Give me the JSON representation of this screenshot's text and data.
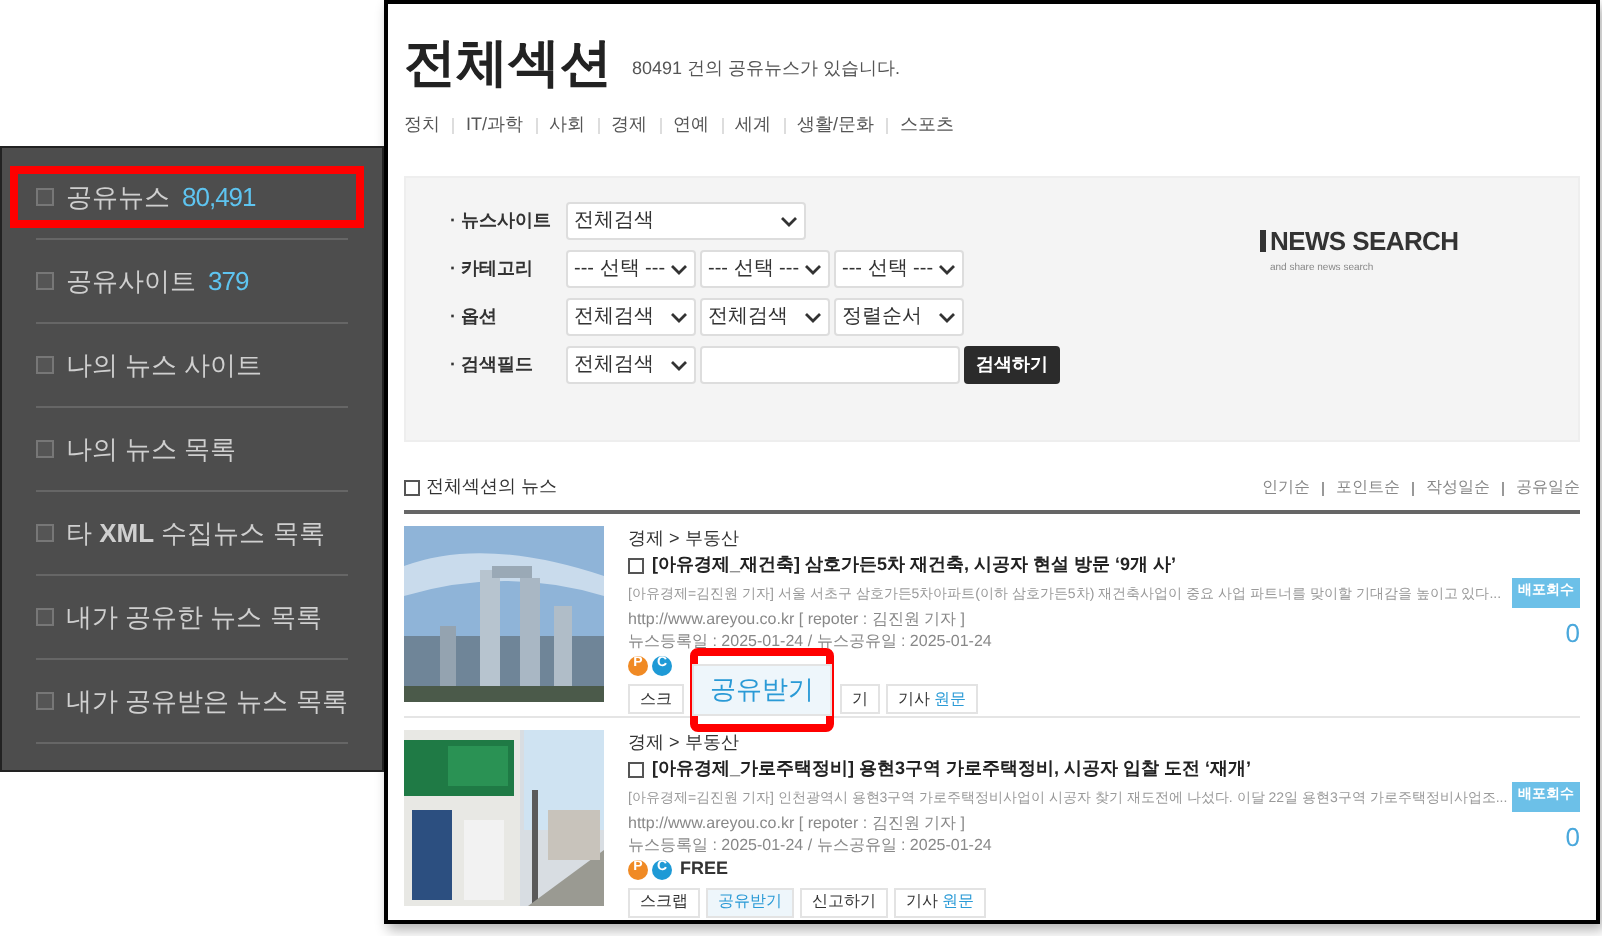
{
  "sidebar": {
    "items": [
      {
        "label": "공유뉴스",
        "count": "80,491",
        "highlighted": true
      },
      {
        "label": "공유사이트",
        "count": "379",
        "highlighted": false
      },
      {
        "label": "나의 뉴스 사이트",
        "highlighted": false
      },
      {
        "label": "나의 뉴스 목록",
        "highlighted": false
      },
      {
        "label": "타 **XML** 수집뉴스 목록",
        "highlighted": false
      },
      {
        "label": "내가 공유한 뉴스 목록",
        "highlighted": false
      },
      {
        "label": "내가 공유받은 뉴스 목록",
        "highlighted": false
      }
    ]
  },
  "page": {
    "title": "전체섹션",
    "subtitle": "80491 건의 공유뉴스가 있습니다.",
    "categories": [
      "정치",
      "IT/과학",
      "사회",
      "경제",
      "연예",
      "세계",
      "생활/문화",
      "스포츠"
    ]
  },
  "search": {
    "rows": [
      {
        "label": "· 뉴스사이트",
        "fields": [
          {
            "kind": "select",
            "value": "전체검색",
            "wide": true
          }
        ]
      },
      {
        "label": "· 카테고리",
        "fields": [
          {
            "kind": "select",
            "value": "--- 선택 ---"
          },
          {
            "kind": "select",
            "value": "--- 선택 ---"
          },
          {
            "kind": "select",
            "value": "--- 선택 ---"
          }
        ]
      },
      {
        "label": "· 옵션",
        "fields": [
          {
            "kind": "select",
            "value": "전체검색"
          },
          {
            "kind": "select",
            "value": "전체검색"
          },
          {
            "kind": "select",
            "value": "정렬순서"
          }
        ]
      },
      {
        "label": "· 검색필드",
        "fields": [
          {
            "kind": "select",
            "value": "전체검색"
          },
          {
            "kind": "input"
          },
          {
            "kind": "button",
            "value": "검색하기"
          }
        ]
      }
    ],
    "logo": {
      "title": "NEWS SEARCH",
      "tagline": "and share news search"
    }
  },
  "list": {
    "title": "전체섹션의 뉴스",
    "checked": false,
    "sort": [
      "인기순",
      "포인트순",
      "작성일순",
      "공유일순"
    ],
    "items": [
      {
        "category": "경제 > 부동산",
        "checked": false,
        "title": "[아유경제_재건축] 삼호가든5차 재건축, 시공자 현설 방문 ‘9개 사’",
        "summary": "[아유경제=김진원 기자] 서울 서초구 삼호가든5차아파트(이하 삼호가든5차) 재건축사업이 중요 사업 파트너를 맞이할 기대감을 높이고 있다...",
        "source": "http://www.areyou.co.kr [ repoter : 김진원 기자 ]",
        "dates": "뉴스등록일 : 2025-01-24 / 뉴스공유일 : 2025-01-24",
        "badges": [
          {
            "letter": "P",
            "color": "#f08a24"
          },
          {
            "letter": "C",
            "color": "#1e9ad6"
          }
        ],
        "buttons": [
          {
            "kind": "plain",
            "label": "스크"
          },
          {
            "kind": "callout",
            "label": "공유받기"
          },
          {
            "kind": "plain",
            "label": "기"
          },
          {
            "kind": "plain",
            "label": "기사",
            "link": "원문"
          }
        ],
        "stat_label": "배포회수",
        "stat": "0"
      },
      {
        "category": "경제 > 부동산",
        "checked": false,
        "title": "[아유경제_가로주택정비] 용현3구역 가로주택정비, 시공자 입찰 도전 ‘재개’",
        "summary": "[아유경제=김진원 기자] 인천광역시 용현3구역 가로주택정비사업이 시공자 찾기 재도전에 나섰다. 이달 22일 용현3구역 가로주택정비사업조...",
        "source": "http://www.areyou.co.kr [ repoter : 김진원 기자 ]",
        "dates": "뉴스등록일 : 2025-01-24 / 뉴스공유일 : 2025-01-24",
        "badges": [
          {
            "letter": "P",
            "color": "#f08a24"
          },
          {
            "letter": "C",
            "color": "#1e9ad6"
          }
        ],
        "price": "FREE",
        "buttons": [
          {
            "kind": "plain",
            "label": "스크랩"
          },
          {
            "kind": "share",
            "label": "공유받기"
          },
          {
            "kind": "plain",
            "label": "신고하기"
          },
          {
            "kind": "plain",
            "label": "기사",
            "link": "원문"
          }
        ],
        "stat_label": "배포회수",
        "stat": "0"
      }
    ]
  }
}
